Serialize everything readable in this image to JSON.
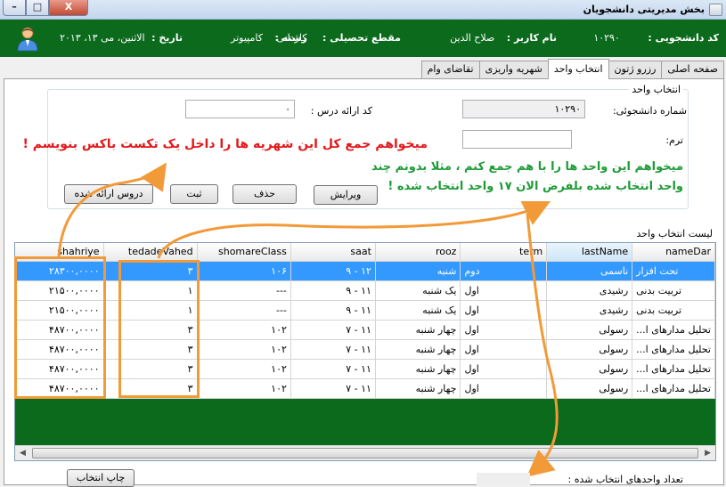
{
  "window": {
    "title": "بخش مديريتی دانشجويان",
    "buttons": {
      "minimize": "–",
      "maximize": "□",
      "close": "X"
    }
  },
  "header": {
    "student_code_label": "کد دانشجويی :",
    "student_code": "۱۰۲۹۰",
    "username_label": "نام کاربر :",
    "username": "صلاح الدين",
    "level_label": "مقطع تحصيلی :",
    "level": "کاردانی",
    "field_label": "رشته :",
    "field": "کامپيوتر",
    "date_label": "تاريخ :",
    "date": "الاثنين، مى ۱۳، ۲۰۱۳",
    "avatar_icon": "user-avatar-icon"
  },
  "tabs": [
    "صفحه اصلی",
    "رزرو ژتون",
    "انتخاب واحد",
    "شهريه واريزی",
    "تقاضای وام"
  ],
  "active_tab": 2,
  "form": {
    "group_title": "انتخاب واحد",
    "student_number_label": "شماره دانشجوئی:",
    "student_number_value": "۱۰۲۹۰",
    "term_label": "ترم:",
    "term_value": "",
    "course_code_label": "کد ارائه درس :",
    "course_code_value": "۰",
    "buttons": {
      "edit": "ويرايش",
      "delete": "حذف",
      "register": "ثبت",
      "offered_courses": "دروس ارائه شده"
    }
  },
  "annotations": {
    "red_note": "ميخواهم جمع کل اين شهريه ها را داخل يک تکست باکس بنويسم !",
    "green_note_line1": "ميخواهم اين واحد ها را با هم جمع کنم ، مثلا بدونم چند",
    "green_note_line2": "واحد انتخاب شده بلفرض الان ۱۷ واحد انتخاب شده !",
    "accent_red": "#e3191c",
    "accent_green": "#1d9b36",
    "accent_orange": "#f29a38"
  },
  "list": {
    "title": "ليست انتخاب واحد",
    "columns": [
      "shahriye",
      "tedadeVahed",
      "shomareClass",
      "saat",
      "rooz",
      "term",
      "lastName",
      "nameDar"
    ],
    "rows": [
      [
        "۲۸۳۰۰,۰۰۰۰",
        "۳",
        "۱۰۶",
        "۱۲ - ۹",
        "شنبه",
        "دوم",
        "ناسمی",
        "تحت افزار"
      ],
      [
        "۲۱۵۰۰,۰۰۰۰",
        "۱",
        "---",
        "۱۱ - ۹",
        "يک شنبه",
        "اول",
        "رشيدی",
        "تربيت بدنی"
      ],
      [
        "۲۱۵۰۰,۰۰۰۰",
        "۱",
        "---",
        "۱۱ - ۹",
        "يک شنبه",
        "اول",
        "رشيدی",
        "تربيت بدنی"
      ],
      [
        "۴۸۷۰۰,۰۰۰۰",
        "۳",
        "۱۰۲",
        "۱۱ - ۷",
        "چهار شنبه",
        "اول",
        "رسولی",
        "تحليل مدارهای ا..."
      ],
      [
        "۴۸۷۰۰,۰۰۰۰",
        "۳",
        "۱۰۲",
        "۱۱ - ۷",
        "چهار شنبه",
        "اول",
        "رسولی",
        "تحليل مدارهای ا..."
      ],
      [
        "۴۸۷۰۰,۰۰۰۰",
        "۳",
        "۱۰۲",
        "۱۱ - ۷",
        "چهار شنبه",
        "اول",
        "رسولی",
        "تحليل مدارهای ا..."
      ],
      [
        "۴۸۷۰۰,۰۰۰۰",
        "۳",
        "۱۰۲",
        "۱۱ - ۷",
        "چهار شنبه",
        "اول",
        "رسولی",
        "تحليل مدارهای ا..."
      ]
    ],
    "selected_row": 0,
    "selected_column": "lastName"
  },
  "footer": {
    "count_label": "تعداد واحدهای انتخاب شده :",
    "print_button": "چاپ انتخاب"
  }
}
